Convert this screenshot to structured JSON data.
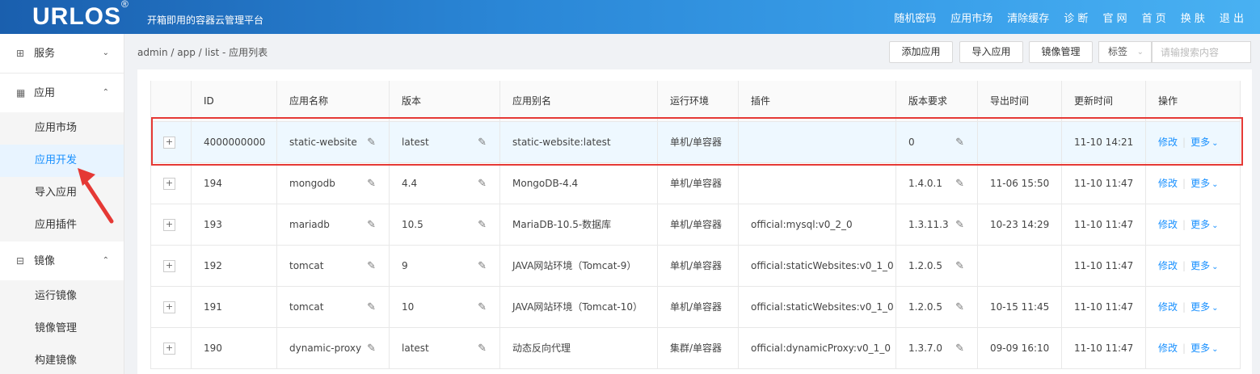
{
  "header": {
    "logo": "URLOS",
    "logo_mark": "®",
    "slogan": "开箱即用的容器云管理平台",
    "nav": [
      "随机密码",
      "应用市场",
      "清除缓存",
      "诊 断",
      "官 网",
      "首 页",
      "换 肤",
      "退 出"
    ]
  },
  "sidebar": {
    "groups": [
      {
        "label": "服务",
        "icon": "grid-icon",
        "expanded": false,
        "items": []
      },
      {
        "label": "应用",
        "icon": "apps-icon",
        "expanded": true,
        "items": [
          "应用市场",
          "应用开发",
          "导入应用",
          "应用插件"
        ]
      },
      {
        "label": "镜像",
        "icon": "drive-icon",
        "expanded": true,
        "items": [
          "运行镜像",
          "镜像管理",
          "构建镜像"
        ]
      }
    ],
    "active_item": "应用开发"
  },
  "breadcrumb": "admin  /  app  /  list  -  应用列表",
  "toolbar": {
    "add": "添加应用",
    "import": "导入应用",
    "images": "镜像管理",
    "tag_label": "标签",
    "search_placeholder": "请输搜索内容"
  },
  "table": {
    "columns": [
      "",
      "ID",
      "应用名称",
      "版本",
      "应用别名",
      "运行环境",
      "插件",
      "版本要求",
      "导出时间",
      "更新时间",
      "操作"
    ],
    "edit_label": "修改",
    "more_label": "更多",
    "rows": [
      {
        "id": "4000000000",
        "name": "static-website",
        "version": "latest",
        "alias": "static-website:latest",
        "env": "单机/单容器",
        "plugin": "",
        "req": "0",
        "exported": "",
        "updated": "11-10 14:21",
        "highlight": true
      },
      {
        "id": "194",
        "name": "mongodb",
        "version": "4.4",
        "alias": "MongoDB-4.4",
        "env": "单机/单容器",
        "plugin": "",
        "req": "1.4.0.1",
        "exported": "11-06 15:50",
        "updated": "11-10 11:47",
        "highlight": false
      },
      {
        "id": "193",
        "name": "mariadb",
        "version": "10.5",
        "alias": "MariaDB-10.5-数据库",
        "env": "单机/单容器",
        "plugin": "official:mysql:v0_2_0",
        "req": "1.3.11.3",
        "exported": "10-23 14:29",
        "updated": "11-10 11:47",
        "highlight": false
      },
      {
        "id": "192",
        "name": "tomcat",
        "version": "9",
        "alias": "JAVA网站环境（Tomcat-9）",
        "env": "单机/单容器",
        "plugin": "official:staticWebsites:v0_1_0",
        "req": "1.2.0.5",
        "exported": "",
        "updated": "11-10 11:47",
        "highlight": false
      },
      {
        "id": "191",
        "name": "tomcat",
        "version": "10",
        "alias": "JAVA网站环境（Tomcat-10）",
        "env": "单机/单容器",
        "plugin": "official:staticWebsites:v0_1_0",
        "req": "1.2.0.5",
        "exported": "10-15 11:45",
        "updated": "11-10 11:47",
        "highlight": false
      },
      {
        "id": "190",
        "name": "dynamic-proxy",
        "version": "latest",
        "alias": "动态反向代理",
        "env": "集群/单容器",
        "plugin": "official:dynamicProxy:v0_1_0",
        "req": "1.3.7.0",
        "exported": "09-09 16:10",
        "updated": "11-10 11:47",
        "highlight": false
      }
    ]
  },
  "colors": {
    "accent": "#1890ff",
    "highlight_box": "#e53935",
    "arrow": "#e53935",
    "recent_update": "#52c41a"
  }
}
